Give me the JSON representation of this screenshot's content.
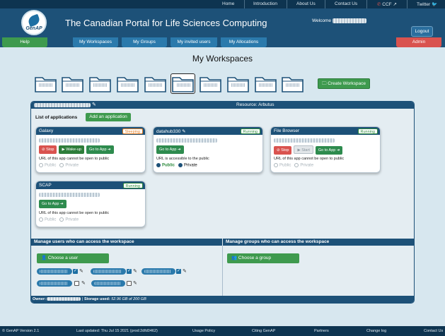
{
  "topnav": {
    "items": [
      "Home",
      "Introduction",
      "About Us",
      "Contact Us",
      "CCF",
      "Twitter"
    ]
  },
  "header": {
    "logo_text": "GenAP",
    "title": "The Canadian Portal for Life Sciences Computing",
    "welcome_label": "Welcome",
    "logout_label": "Logout"
  },
  "nav": {
    "help": "Help",
    "my_workspaces": "My Workspaces",
    "my_groups": "My Groups",
    "my_invited_users": "My invited users",
    "my_allocations": "My Allocations",
    "admin": "Admin"
  },
  "page": {
    "title": "My Workspaces",
    "create_workspace": "Create Workspace"
  },
  "workspace": {
    "resource": "Resource: Arbutus",
    "list_title": "List of applications",
    "add_app": "Add an application",
    "apps": [
      {
        "name": "Galaxy",
        "status": "Sleeping",
        "buttons": [
          "Stop",
          "Wake-up",
          "Go to App"
        ],
        "note": "URL of this app cannot be open to public",
        "public": "Public",
        "private": "Private"
      },
      {
        "name": "datahub330",
        "status": "Running",
        "buttons": [
          "Go to App"
        ],
        "note": "URL is accessible to the public",
        "public": "Public",
        "private": "Private"
      },
      {
        "name": "File Browser",
        "status": "Running",
        "buttons": [
          "Stop",
          "Start",
          "Go to App"
        ],
        "note": "URL of this app cannot be open to public",
        "public": "Public",
        "private": "Private"
      },
      {
        "name": "SCAP",
        "status": "Running",
        "buttons": [
          "Go to App"
        ],
        "note": "URL of this app cannot be open to public",
        "public": "Public",
        "private": "Private"
      }
    ],
    "manage_users_title": "Manage users who can access the workspace",
    "manage_groups_title": "Manage groups who can access the workspace",
    "choose_user": "Choose a user",
    "choose_group": "Choose a group",
    "footer_owner": "Owner:",
    "footer_storage": "Storage used:",
    "footer_storage_value": "52.96 GB of 200 GB"
  },
  "footer": {
    "version": "© GenAP Version 2.1",
    "updated": "Last updated: Thu Jul 15 2021 (prod:2dfd0462)",
    "usage_policy": "Usage Policy",
    "citing": "Citing GenAP",
    "partners": "Partners",
    "changelog": "Change log",
    "contact": "Contact Us"
  },
  "colors": {
    "dark_navy": "#0e3450",
    "header_blue": "#1d5178",
    "button_blue": "#2b7aac",
    "green": "#3e9a4e",
    "red": "#d9534f",
    "background": "#d7e7ef"
  }
}
